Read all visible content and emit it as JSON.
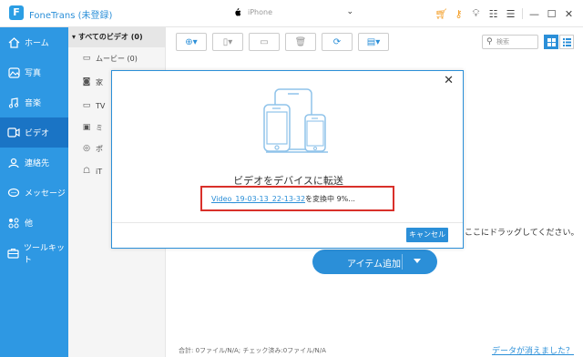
{
  "app": {
    "title": "FoneTrans (未登録)",
    "logo_letter": "F",
    "device_name": "iPhone"
  },
  "titlebar_icons": [
    "cart-icon",
    "key-icon",
    "lightbulb-icon",
    "feedback-icon",
    "menu-icon",
    "minimize-icon",
    "maximize-icon",
    "close-icon"
  ],
  "sidebar": {
    "items": [
      {
        "label": "ホーム",
        "icon": "home-icon"
      },
      {
        "label": "写真",
        "icon": "photo-icon"
      },
      {
        "label": "音楽",
        "icon": "music-icon"
      },
      {
        "label": "ビデオ",
        "icon": "video-icon",
        "active": true
      },
      {
        "label": "連絡先",
        "icon": "contact-icon"
      },
      {
        "label": "メッセージ",
        "icon": "message-icon"
      },
      {
        "label": "他",
        "icon": "other-icon"
      },
      {
        "label": "ツールキット",
        "icon": "toolkit-icon"
      }
    ]
  },
  "categories": {
    "header": "すべてのビデオ (0)",
    "items": [
      {
        "label": "ムービー (0)",
        "icon": "movie-icon"
      },
      {
        "label": "家",
        "icon": "home-video-icon"
      },
      {
        "label": "TV",
        "icon": "tv-icon"
      },
      {
        "label": "ミ",
        "icon": "music-video-icon"
      },
      {
        "label": "ポ",
        "icon": "podcast-icon"
      },
      {
        "label": "iT",
        "icon": "itunes-u-icon"
      }
    ]
  },
  "search": {
    "placeholder": "検索"
  },
  "main": {
    "drag_hint": "ここにドラッグしてください。",
    "add_button": "アイテム追加"
  },
  "status": {
    "summary": "合計: 0ファイル/N/A; チェック済み:0ファイル/N/A",
    "link": "データが消えました？"
  },
  "dialog": {
    "title": "ビデオをデバイスに転送",
    "file_name": "Video_19-03-13_22-13-32",
    "progress_text": "を変換中 9%...",
    "cancel": "キャンセル"
  },
  "colors": {
    "accent": "#2b8fd8",
    "sidebar": "#2e98e3",
    "sidebar_active": "#1a74c5",
    "highlight_border": "#d9302a"
  }
}
